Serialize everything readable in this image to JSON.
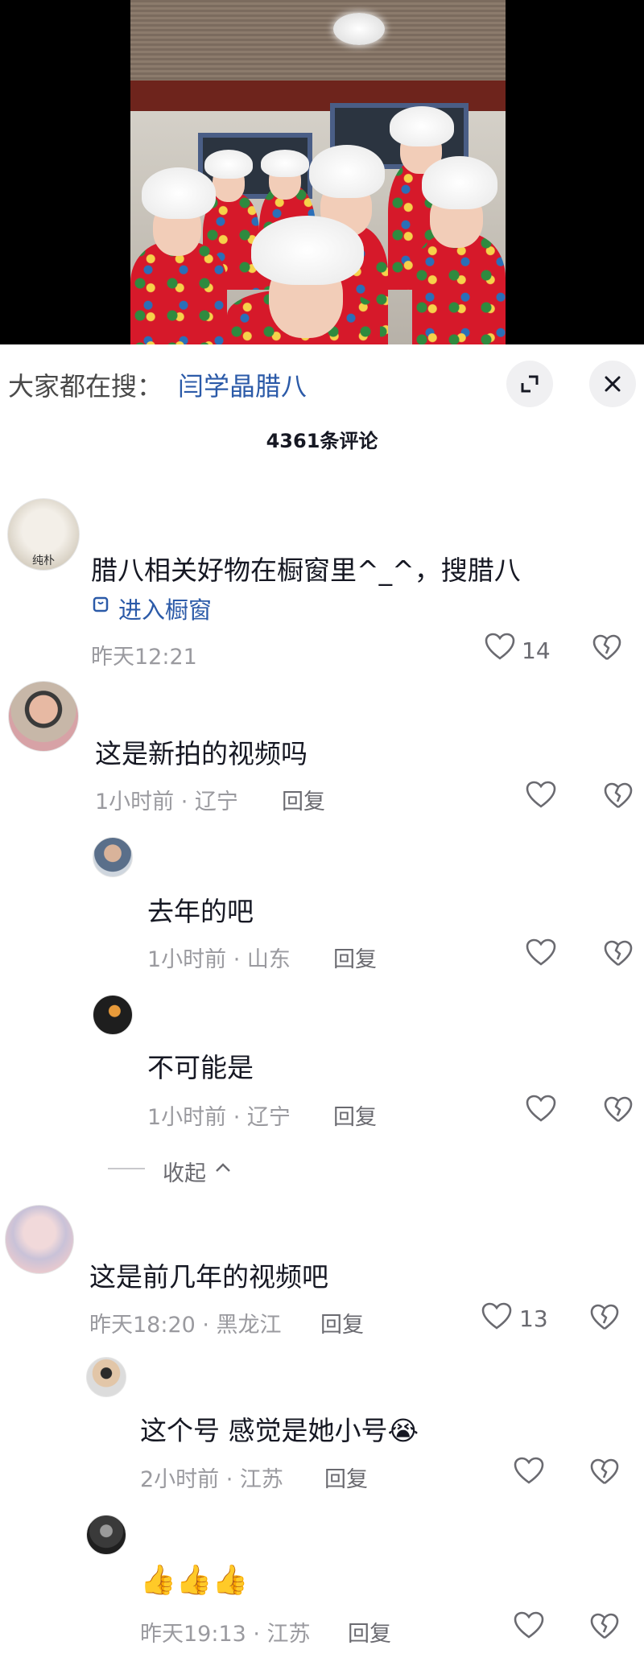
{
  "search": {
    "prefix": "大家都在搜：",
    "term": "闫学晶腊八"
  },
  "header": {
    "comment_count": "4361条评论"
  },
  "comments": [
    {
      "text": "腊八相关好物在橱窗里^_^，搜腊八",
      "link": "进入橱窗",
      "time": "昨天12:21",
      "likes": "14",
      "avatar_label": "纯朴"
    },
    {
      "text": "这是新拍的视频吗",
      "time": "1小时前 · 辽宁",
      "reply": "回复"
    },
    {
      "text": "去年的吧",
      "time": "1小时前 · 山东",
      "reply": "回复"
    },
    {
      "text": "不可能是",
      "time": "1小时前 · 辽宁",
      "reply": "回复"
    },
    {
      "text": "这是前几年的视频吧",
      "time": "昨天18:20 · 黑龙江",
      "reply": "回复",
      "likes": "13"
    },
    {
      "text": "这个号 感觉是她小号😭",
      "time": "2小时前 · 江苏",
      "reply": "回复"
    },
    {
      "text": "👍👍👍",
      "time": "昨天19:13 · 江苏",
      "reply": "回复"
    }
  ],
  "collapse": {
    "label": "收起"
  },
  "colors": {
    "accent_blue": "#2b5aa8",
    "meta_gray": "#9a9a9f",
    "coat_red": "#d6192a"
  },
  "icons": [
    "expand-icon",
    "close-icon",
    "shop-window-icon",
    "like-heart-icon",
    "dislike-broken-heart-icon",
    "chevron-up-icon"
  ]
}
